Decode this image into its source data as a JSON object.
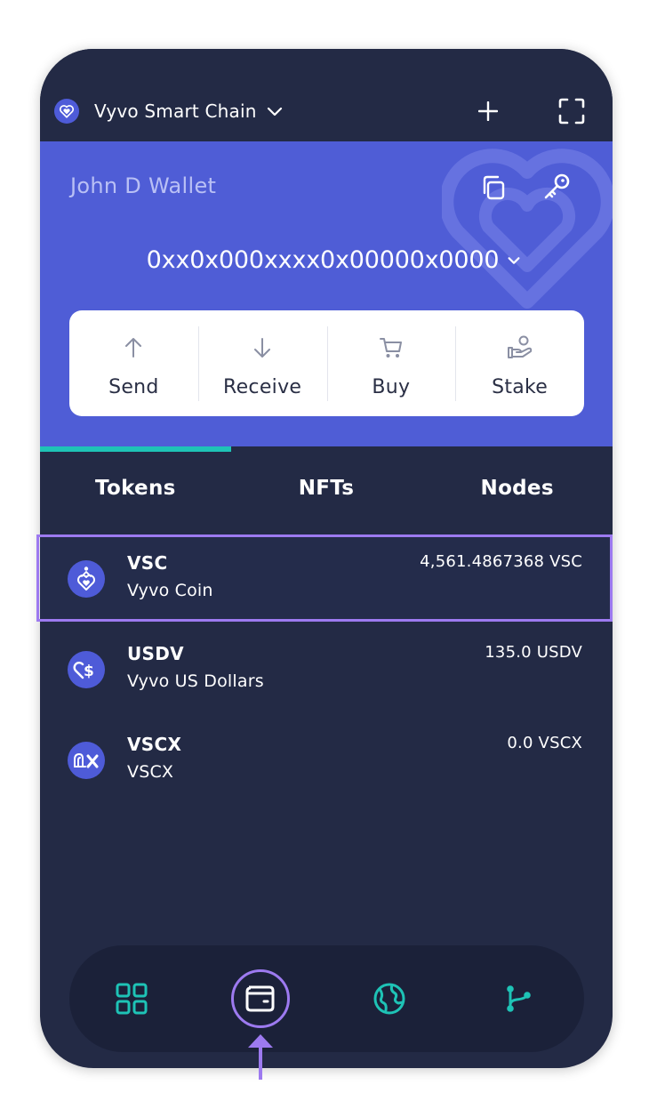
{
  "header": {
    "network_name": "Vyvo Smart Chain",
    "network_icon": "vyvo-heart-logo-icon",
    "add_icon": "plus-icon",
    "scan_icon": "scan-frame-icon"
  },
  "wallet": {
    "name": "John D Wallet",
    "address": "0xx0x000xxxx0x00000x0000",
    "copy_icon": "copy-icon",
    "key_icon": "key-icon"
  },
  "actions": [
    {
      "label": "Send",
      "icon": "arrow-up-icon"
    },
    {
      "label": "Receive",
      "icon": "arrow-down-icon"
    },
    {
      "label": "Buy",
      "icon": "cart-icon"
    },
    {
      "label": "Stake",
      "icon": "stake-hand-icon"
    }
  ],
  "tabs": [
    {
      "label": "Tokens",
      "active": true
    },
    {
      "label": "NFTs",
      "active": false
    },
    {
      "label": "Nodes",
      "active": false
    }
  ],
  "tokens": [
    {
      "symbol": "VSC",
      "name": "Vyvo Coin",
      "balance": "4,561.4867368 VSC",
      "icon": "vyvo-coin-icon",
      "highlighted": true
    },
    {
      "symbol": "USDV",
      "name": "Vyvo US Dollars",
      "balance": "135.0 USDV",
      "icon": "usd-heart-icon"
    },
    {
      "symbol": "VSCX",
      "name": "VSCX",
      "balance": "0.0 VSCX",
      "icon": "vscx-icon"
    }
  ],
  "bottom_nav": [
    {
      "name": "dashboard",
      "icon": "grid-icon"
    },
    {
      "name": "wallet",
      "icon": "wallet-icon",
      "active": true
    },
    {
      "name": "browser",
      "icon": "globe-icon"
    },
    {
      "name": "connections",
      "icon": "branch-icon"
    }
  ],
  "colors": {
    "background": "#232a45",
    "card": "#4f5dd6",
    "accent_teal": "#1ec3b6",
    "highlight_purple": "#9d7af0"
  }
}
